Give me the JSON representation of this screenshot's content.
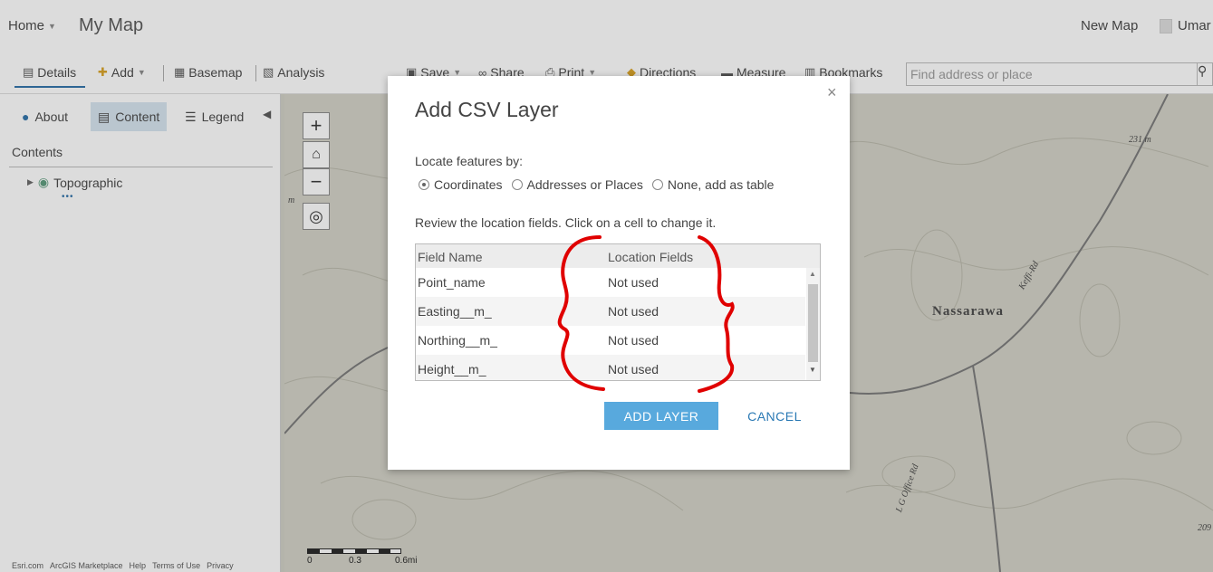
{
  "header": {
    "home_label": "Home",
    "map_title": "My Map",
    "new_map_label": "New Map",
    "user_label": "Umar"
  },
  "toolbar": {
    "details": "Details",
    "add": "Add",
    "basemap": "Basemap",
    "analysis": "Analysis",
    "save": "Save",
    "share": "Share",
    "print": "Print",
    "directions": "Directions",
    "measure": "Measure",
    "bookmarks": "Bookmarks",
    "search_placeholder": "Find address or place"
  },
  "sidebar": {
    "tabs": {
      "about": "About",
      "content": "Content",
      "legend": "Legend"
    },
    "contents_label": "Contents",
    "layers": [
      {
        "name": "Topographic"
      }
    ],
    "footer_links": [
      "Esri.com",
      "ArcGIS Marketplace",
      "Help",
      "Terms of Use",
      "Privacy"
    ]
  },
  "map": {
    "labels": {
      "town": "Nassarawa",
      "road1": "Keffi-Rd",
      "road2": "L G Office Rd",
      "elev1": "231 m",
      "elev2": "m",
      "elev3": "209"
    },
    "scale": {
      "l0": "0",
      "l1": "0.3",
      "l2": "0.6mi"
    }
  },
  "dialog": {
    "title": "Add CSV Layer",
    "close_glyph": "×",
    "locate_label": "Locate features by:",
    "locate_options": [
      {
        "label": "Coordinates",
        "checked": true
      },
      {
        "label": "Addresses or Places",
        "checked": false
      },
      {
        "label": "None, add as table",
        "checked": false
      }
    ],
    "review_text": "Review the location fields. Click on a cell to change it.",
    "table": {
      "headers": [
        "Field Name",
        "Location Fields"
      ],
      "rows": [
        {
          "field": "Point_name",
          "location": "Not used"
        },
        {
          "field": "Easting__m_",
          "location": "Not used"
        },
        {
          "field": "Northing__m_",
          "location": "Not used"
        },
        {
          "field": "Height__m_",
          "location": "Not used"
        }
      ]
    },
    "add_button": "ADD LAYER",
    "cancel_button": "CANCEL"
  },
  "colors": {
    "accent": "#58a9dd",
    "link": "#2a79b4",
    "annotation": "#e00000"
  },
  "icons": [
    "details-icon",
    "add-icon",
    "basemap-icon",
    "analysis-icon",
    "save-icon",
    "share-icon",
    "print-icon",
    "directions-icon",
    "measure-icon",
    "bookmarks-icon",
    "search-icon",
    "info-icon",
    "content-icon",
    "legend-icon",
    "globe-icon",
    "home-icon",
    "locate-icon"
  ]
}
